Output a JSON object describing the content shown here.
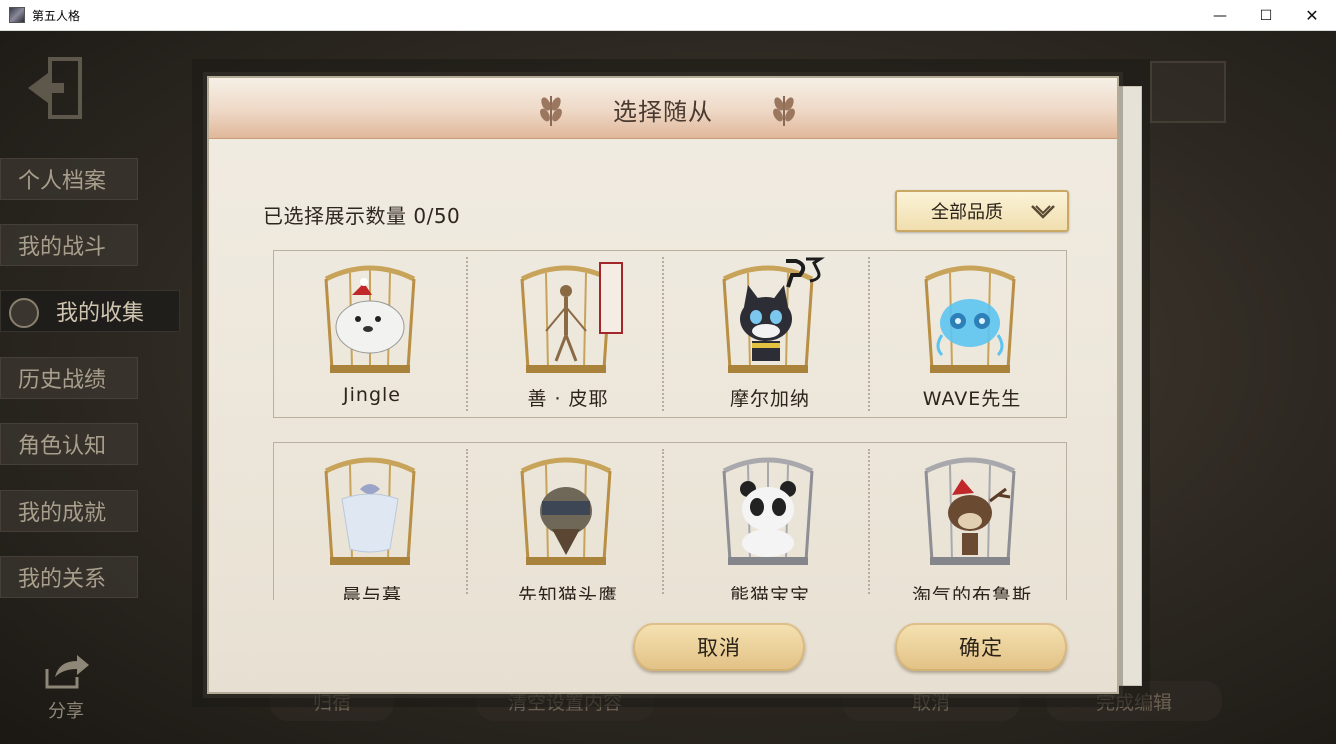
{
  "window": {
    "title": "第五人格",
    "minimize": "—",
    "maximize": "☐",
    "close": "✕"
  },
  "sidebar": {
    "items": [
      {
        "label": "个人档案"
      },
      {
        "label": "我的战斗"
      },
      {
        "label": "我的收集"
      },
      {
        "label": "历史战绩"
      },
      {
        "label": "角色认知"
      },
      {
        "label": "我的成就"
      },
      {
        "label": "我的关系"
      }
    ],
    "active_index": 2,
    "share_label": "分享"
  },
  "background_bar": {
    "home": "归宿",
    "clear": "清空设置内容",
    "cancel": "取消",
    "finish": "完成编辑"
  },
  "dialog": {
    "title": "选择随从",
    "count_label": "已选择展示数量 0/50",
    "filter": {
      "selected": "全部品质"
    },
    "companions": [
      {
        "name": "Jingle",
        "cage": "gold",
        "icon": "dog-icon"
      },
      {
        "name": "善 · 皮耶",
        "cage": "gold",
        "icon": "puppet-icon"
      },
      {
        "name": "摩尔加纳",
        "cage": "gold",
        "icon": "cat-icon"
      },
      {
        "name": "WAVE先生",
        "cage": "gold",
        "icon": "jellyfish-icon"
      },
      {
        "name": "晨与暮",
        "cage": "gold",
        "icon": "wing-icon"
      },
      {
        "name": "先知猫头鹰",
        "cage": "gold",
        "icon": "owl-icon"
      },
      {
        "name": "熊猫宝宝",
        "cage": "silver",
        "icon": "panda-icon"
      },
      {
        "name": "淘气的布鲁斯",
        "cage": "silver",
        "icon": "reindeer-icon"
      }
    ],
    "cancel_button": "取消",
    "confirm_button": "确定",
    "colors": {
      "gold": "#c8a35a",
      "silver": "#a9a9ad",
      "accent": "#e0b79a"
    }
  }
}
